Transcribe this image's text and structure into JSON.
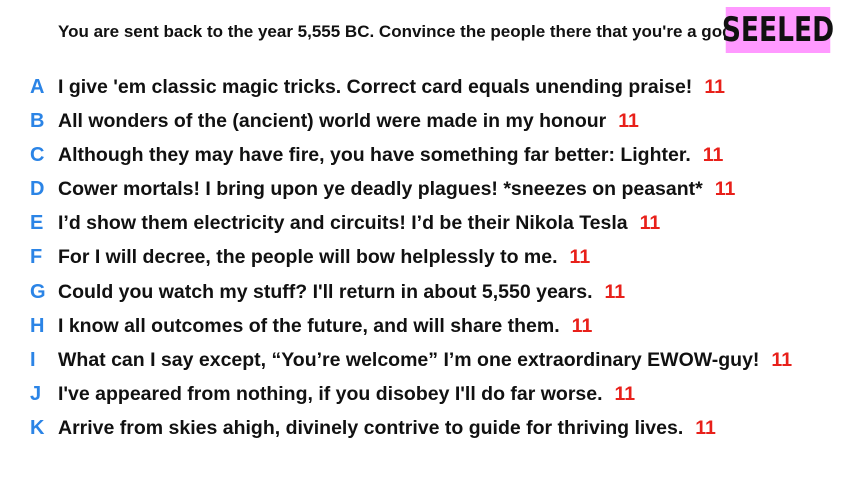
{
  "prompt": "You are sent back to the year 5,555 BC. Convince the people there that you're a god.",
  "badge": "SEELED",
  "colors": {
    "letter": "#2b84e6",
    "score": "#e8201a",
    "badge_bg": "#ff99ff",
    "text": "#111111"
  },
  "responses": [
    {
      "letter": "A",
      "text": "I give 'em classic magic tricks. Correct card equals unending praise!",
      "score": "11"
    },
    {
      "letter": "B",
      "text": "All wonders of the (ancient) world were made in my honour",
      "score": "11"
    },
    {
      "letter": "C",
      "text": "Although they may have fire, you have something far better: Lighter.",
      "score": "11"
    },
    {
      "letter": "D",
      "text": "Cower mortals! I bring upon ye deadly plagues! *sneezes on peasant*",
      "score": "11"
    },
    {
      "letter": "E",
      "text": "I’d show them electricity and circuits! I’d be their Nikola Tesla",
      "score": "11"
    },
    {
      "letter": "F",
      "text": "For I will decree, the people will bow helplessly to me.",
      "score": "11"
    },
    {
      "letter": "G",
      "text": "Could you watch my stuff? I'll return in about 5,550 years.",
      "score": "11"
    },
    {
      "letter": "H",
      "text": "I know all outcomes of the future, and will share them.",
      "score": "11"
    },
    {
      "letter": "I",
      "text": "What can I say except, “You’re welcome” I’m one extraordinary EWOW-guy!",
      "score": "11"
    },
    {
      "letter": "J",
      "text": "I've appeared from nothing, if you disobey I'll do far worse.",
      "score": "11"
    },
    {
      "letter": "K",
      "text": "Arrive from skies ahigh, divinely contrive to guide for thriving lives.",
      "score": "11"
    }
  ]
}
